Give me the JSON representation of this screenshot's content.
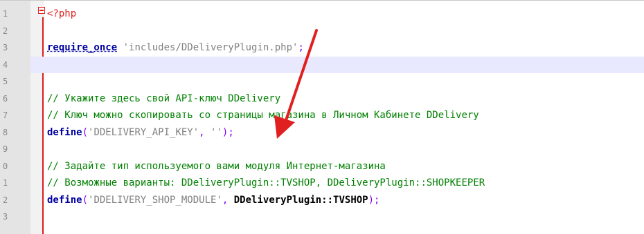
{
  "editor": {
    "lines": [
      {
        "num": "1",
        "tokens": [
          {
            "type": "php",
            "text": "<?php"
          }
        ]
      },
      {
        "num": "2",
        "tokens": []
      },
      {
        "num": "3",
        "tokens": [
          {
            "type": "kw",
            "text": "require_once"
          },
          {
            "type": "plain",
            "text": " "
          },
          {
            "type": "str",
            "text": "'includes/DDeliveryPlugin.php'"
          },
          {
            "type": "op",
            "text": ";"
          }
        ]
      },
      {
        "num": "4",
        "tokens": [],
        "current": true
      },
      {
        "num": "5",
        "tokens": []
      },
      {
        "num": "6",
        "tokens": [
          {
            "type": "cmt",
            "text": "// Укажите здесь свой API-ключ DDelivery"
          }
        ]
      },
      {
        "num": "7",
        "tokens": [
          {
            "type": "cmt",
            "text": "// Ключ можно скопировать со страницы магазина в Личном Кабинете DDelivery"
          }
        ]
      },
      {
        "num": "8",
        "tokens": [
          {
            "type": "kw",
            "text": "define"
          },
          {
            "type": "op",
            "text": "("
          },
          {
            "type": "str",
            "text": "'DDELIVERY_API_KEY'"
          },
          {
            "type": "op",
            "text": ", "
          },
          {
            "type": "str",
            "text": "''"
          },
          {
            "type": "op",
            "text": ");"
          }
        ]
      },
      {
        "num": "9",
        "tokens": []
      },
      {
        "num": "0",
        "tokens": [
          {
            "type": "cmt",
            "text": "// Задайте тип используемого вами модуля Интернет-магазина"
          }
        ]
      },
      {
        "num": "1",
        "tokens": [
          {
            "type": "cmt",
            "text": "// Возможные варианты: DDeliveryPlugin::TVSHOP, DDeliveryPlugin::SHOPKEEPER"
          }
        ]
      },
      {
        "num": "2",
        "tokens": [
          {
            "type": "kw",
            "text": "define"
          },
          {
            "type": "op",
            "text": "("
          },
          {
            "type": "str",
            "text": "'DDELIVERY_SHOP_MODULE'"
          },
          {
            "type": "op",
            "text": ", "
          },
          {
            "type": "cls",
            "text": "DDeliveryPlugin::TVSHOP"
          },
          {
            "type": "op",
            "text": ");"
          }
        ]
      },
      {
        "num": "3",
        "tokens": []
      }
    ]
  },
  "colors": {
    "php_tag": "#e02020",
    "keyword": "#0000a0",
    "string": "#808080",
    "comment": "#008000",
    "operator": "#8000ff",
    "current_line": "#e8e8ff",
    "arrow": "#e02020"
  },
  "icons": {
    "fold": "fold-minus-icon",
    "annotation": "red-arrow-annotation"
  }
}
